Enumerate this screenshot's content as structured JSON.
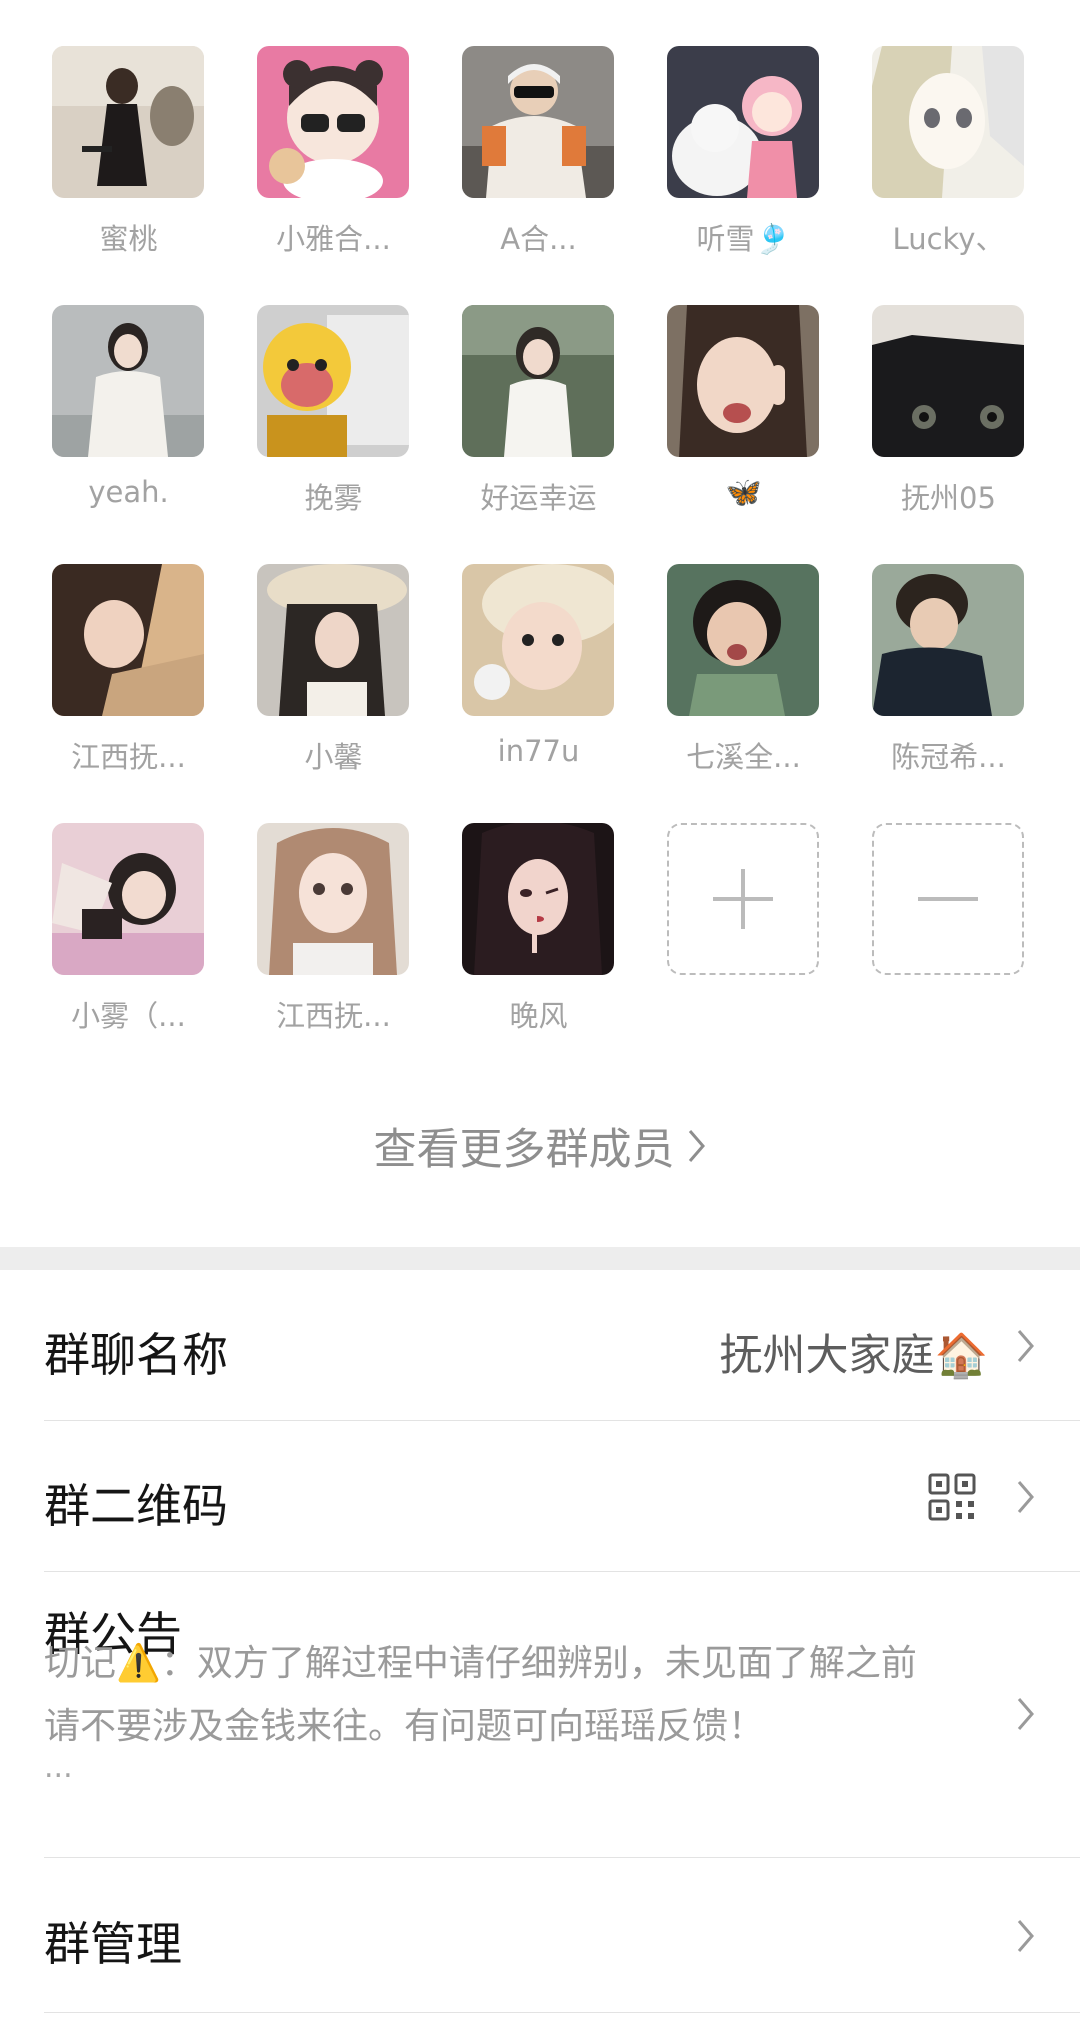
{
  "members": [
    {
      "name": "蜜桃"
    },
    {
      "name": "小雅合..."
    },
    {
      "name": "A合..."
    },
    {
      "name": "听雪🎐"
    },
    {
      "name": "Lucky、"
    },
    {
      "name": "yeah."
    },
    {
      "name": "挽雾"
    },
    {
      "name": "好运幸运"
    },
    {
      "name": "🦋"
    },
    {
      "name": "抚州05"
    },
    {
      "name": "江西抚..."
    },
    {
      "name": "小馨"
    },
    {
      "name": "in77u"
    },
    {
      "name": "七溪全..."
    },
    {
      "name": "陈冠希..."
    },
    {
      "name": "小雾（..."
    },
    {
      "name": "江西抚..."
    },
    {
      "name": "晚风"
    }
  ],
  "controls": {
    "add_icon": "plus-icon",
    "remove_icon": "minus-icon"
  },
  "more_members_label": "查看更多群成员",
  "settings": {
    "group_name": {
      "label": "群聊名称",
      "value": "抚州大家庭🏠"
    },
    "group_qr": {
      "label": "群二维码",
      "icon": "qr-code-icon"
    },
    "announcement": {
      "label": "群公告",
      "line1": "切记⚠️：双方了解过程中请仔细辨别，未见面了解之前",
      "line2": "请不要涉及金钱来往。有问题可向瑶瑶反馈！",
      "ellipsis": "..."
    },
    "group_manage": {
      "label": "群管理"
    }
  },
  "colors": {
    "text_primary": "#151515",
    "text_secondary": "#a2a2a2",
    "divider": "#e3e3e3",
    "section_gap": "#ededed"
  }
}
